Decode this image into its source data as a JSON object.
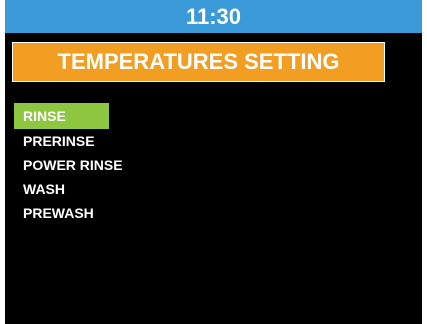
{
  "status_bar": {
    "time": "11:30"
  },
  "header": {
    "title": "TEMPERATURES SETTING"
  },
  "menu": {
    "items": [
      {
        "label": "RINSE",
        "selected": true
      },
      {
        "label": "PRERINSE",
        "selected": false
      },
      {
        "label": "POWER RINSE",
        "selected": false
      },
      {
        "label": "WASH",
        "selected": false
      },
      {
        "label": "PREWASH",
        "selected": false
      }
    ]
  },
  "colors": {
    "status_bar": "#3a9ad8",
    "title_banner": "#f29e22",
    "selected_item": "#8dc63f",
    "screen_background": "#000000",
    "text": "#ffffff"
  }
}
